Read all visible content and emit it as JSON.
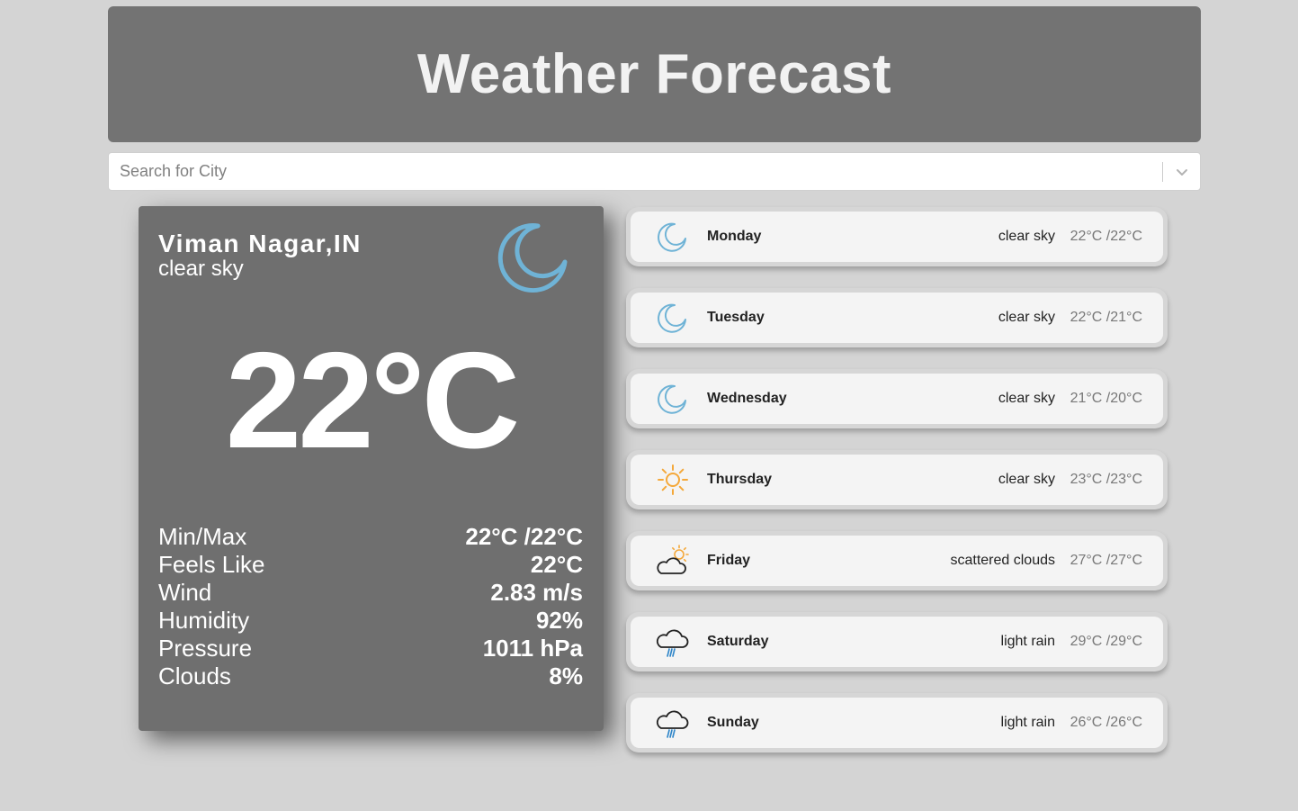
{
  "header": {
    "title": "Weather Forecast"
  },
  "search": {
    "placeholder": "Search for City",
    "value": ""
  },
  "current": {
    "city": "Viman Nagar,IN",
    "description": "clear sky",
    "temperature": "22°C",
    "icon": "moon-icon",
    "details": [
      {
        "label": "Min/Max",
        "value": "22°C /22°C"
      },
      {
        "label": "Feels Like",
        "value": "22°C"
      },
      {
        "label": "Wind",
        "value": "2.83 m/s"
      },
      {
        "label": "Humidity",
        "value": "92%"
      },
      {
        "label": "Pressure",
        "value": "1011 hPa"
      },
      {
        "label": "Clouds",
        "value": "8%"
      }
    ]
  },
  "forecast": [
    {
      "day": "Monday",
      "description": "clear sky",
      "range": "22°C /22°C",
      "icon": "moon-icon"
    },
    {
      "day": "Tuesday",
      "description": "clear sky",
      "range": "22°C /21°C",
      "icon": "moon-icon"
    },
    {
      "day": "Wednesday",
      "description": "clear sky",
      "range": "21°C /20°C",
      "icon": "moon-icon"
    },
    {
      "day": "Thursday",
      "description": "clear sky",
      "range": "23°C /23°C",
      "icon": "sun-icon"
    },
    {
      "day": "Friday",
      "description": "scattered clouds",
      "range": "27°C /27°C",
      "icon": "sun-cloud-icon"
    },
    {
      "day": "Saturday",
      "description": "light rain",
      "range": "29°C /29°C",
      "icon": "rain-cloud-icon"
    },
    {
      "day": "Sunday",
      "description": "light rain",
      "range": "26°C /26°C",
      "icon": "rain-cloud-icon"
    }
  ],
  "colors": {
    "background": "#d4d4d4",
    "header": "#737373",
    "panel": "#6f6f6f",
    "moon": "#6fb3d6",
    "sun": "#f4a83a"
  }
}
